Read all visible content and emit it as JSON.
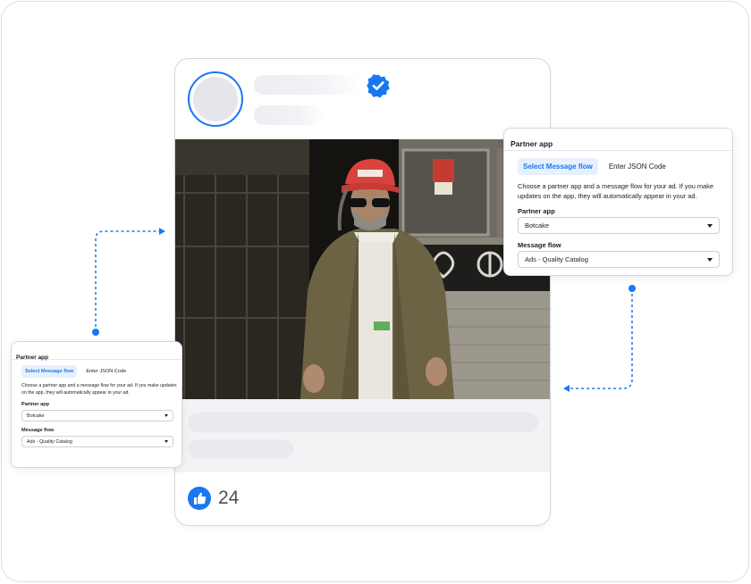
{
  "post": {
    "like_count": "24",
    "icons": {
      "verified": "verified-badge-icon",
      "like": "thumbs-up-icon"
    }
  },
  "partner_panel_large": {
    "title": "Partner app",
    "tabs": [
      {
        "label": "Select Message flow",
        "active": true
      },
      {
        "label": "Enter JSON Code",
        "active": false
      }
    ],
    "description": "Choose a partner app and a message flow for your ad. If you make updates on the app, they will automatically appear in your ad.",
    "partner_app_label": "Partner app",
    "partner_app_value": "Botcake",
    "message_flow_label": "Message flow",
    "message_flow_value": "Ads - Quality Catalog"
  },
  "partner_panel_small": {
    "title": "Partner app",
    "tabs": [
      {
        "label": "Select Message flow",
        "active": true
      },
      {
        "label": "Enter JSON Code",
        "active": false
      }
    ],
    "description": "Choose a partner app and a message flow for your ad. If you make updates on the app, they will automatically appear in your ad.",
    "partner_app_label": "Partner app",
    "partner_app_value": "Botcake",
    "message_flow_label": "Message flow",
    "message_flow_value": "Ads - Quality Catalog"
  },
  "colors": {
    "accent": "#1877f2",
    "skeleton": "#eceef2",
    "tab_active_bg": "#e7f0fd"
  }
}
